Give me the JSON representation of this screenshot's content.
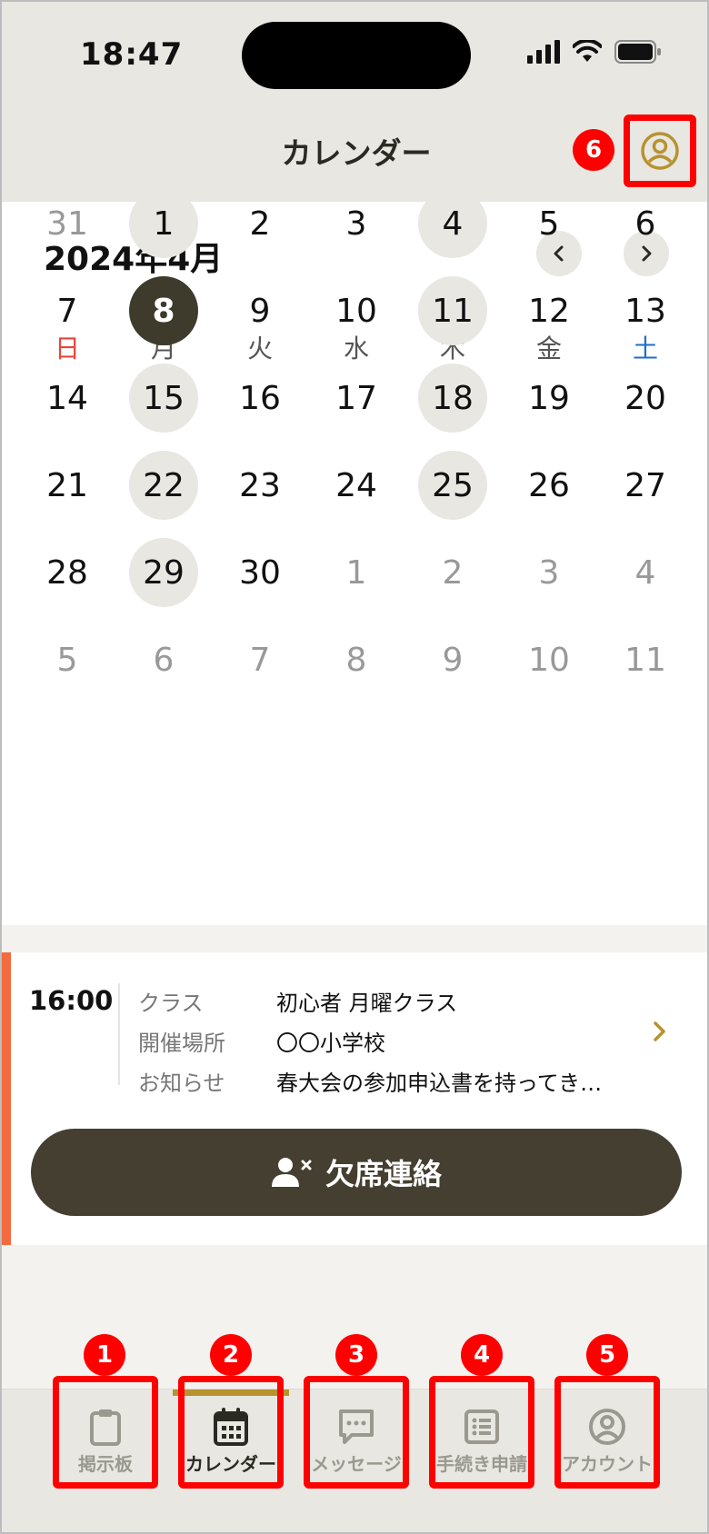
{
  "status_bar": {
    "time": "18:47"
  },
  "header": {
    "title": "カレンダー",
    "profile_badge": "6"
  },
  "calendar": {
    "month_label": "2024年4月",
    "weekdays": [
      "日",
      "月",
      "火",
      "水",
      "木",
      "金",
      "土"
    ],
    "weekday_colors": {
      "sunday": "#e8453c",
      "saturday": "#1e6fc8",
      "default": "#555555"
    },
    "weeks": [
      [
        "31",
        "1",
        "2",
        "3",
        "4",
        "5",
        "6"
      ],
      [
        "7",
        "8",
        "9",
        "10",
        "11",
        "12",
        "13"
      ],
      [
        "14",
        "15",
        "16",
        "17",
        "18",
        "19",
        "20"
      ],
      [
        "21",
        "22",
        "23",
        "24",
        "25",
        "26",
        "27"
      ],
      [
        "28",
        "29",
        "30",
        "1",
        "2",
        "3",
        "4"
      ],
      [
        "5",
        "6",
        "7",
        "8",
        "9",
        "10",
        "11"
      ]
    ],
    "selected_day": "8",
    "highlighted_days": [
      "1",
      "4",
      "8",
      "11",
      "15",
      "18",
      "22",
      "25",
      "29"
    ]
  },
  "event": {
    "time": "16:00",
    "rows": [
      {
        "label": "クラス",
        "value": "初心者 月曜クラス"
      },
      {
        "label": "開催場所",
        "value": "〇〇小学校"
      },
      {
        "label": "お知らせ",
        "value": "春大会の参加申込書を持ってき…"
      }
    ],
    "absence_button": "欠席連絡",
    "accent_color": "#f26a3d"
  },
  "tabs": [
    {
      "label": "掲示板",
      "icon": "clipboard-icon",
      "badge": "1",
      "active": false
    },
    {
      "label": "カレンダー",
      "icon": "calendar-icon",
      "badge": "2",
      "active": true
    },
    {
      "label": "メッセージ",
      "icon": "message-icon",
      "badge": "3",
      "active": false
    },
    {
      "label": "手続き申請",
      "icon": "list-icon",
      "badge": "4",
      "active": false
    },
    {
      "label": "アカウント",
      "icon": "account-icon",
      "badge": "5",
      "active": false
    }
  ],
  "colors": {
    "highlight_box": "#ff0000",
    "dark": "#3f3b2c",
    "gold": "#b8922e"
  }
}
